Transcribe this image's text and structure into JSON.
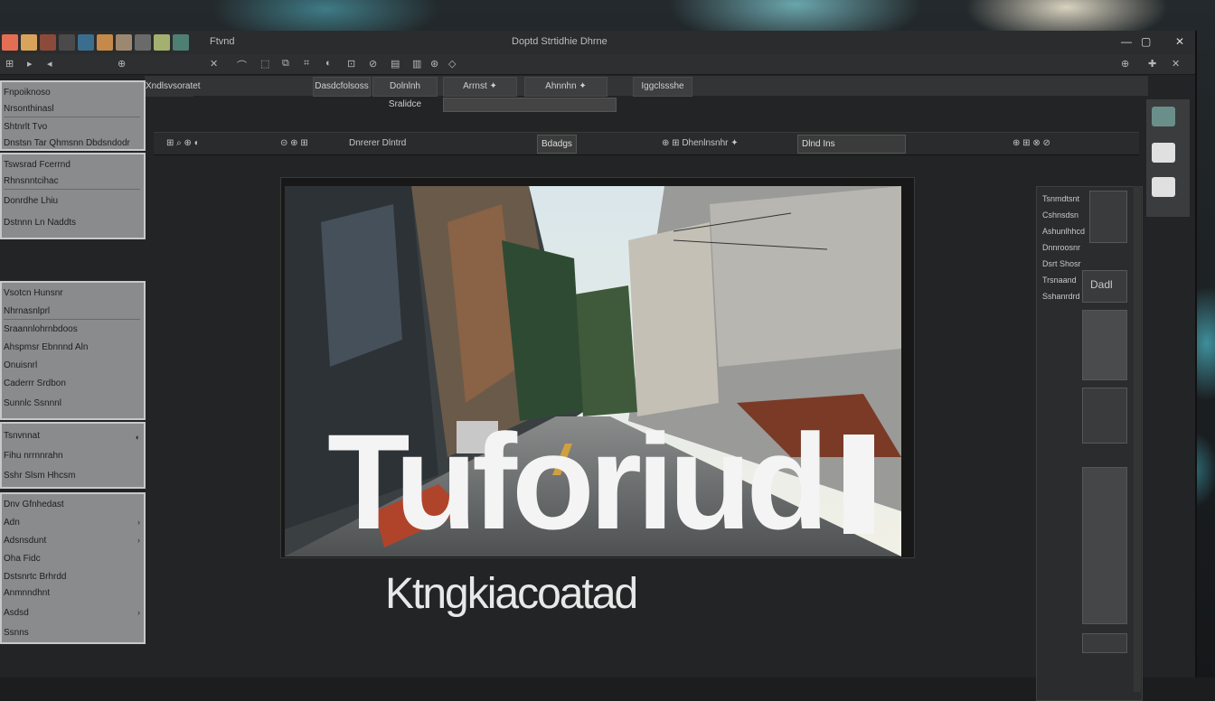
{
  "titlebar": {
    "app_label": "Ftvnd",
    "doc_title": "Doptd Strtidhie Dhrne",
    "win_buttons": [
      "—",
      "▢",
      "✕"
    ],
    "thumb_colors": [
      "#e46e54",
      "#d8a45c",
      "#8b4a3a",
      "#4a4a4a",
      "#3b6e8e",
      "#c58a4a",
      "#9c8870",
      "#6a6a6a",
      "#a4b070",
      "#4e7f73"
    ]
  },
  "toolbar": {
    "glyphs": [
      "⊞",
      "▸",
      "◂",
      "⊕",
      "✕",
      "⌒",
      "⬚",
      "⧉",
      "⌗",
      "◐",
      "⊡",
      "⊘",
      "▤",
      "▥",
      "⊛",
      "◇",
      "⬒",
      "⊠",
      "✚"
    ],
    "right_glyphs": [
      "⊕",
      "✚",
      "✕"
    ]
  },
  "optbar": {
    "left_label": "Xndlsvsoratet",
    "cells": [
      "Dasdcfolsoss",
      "Dolnlnh Sralidce",
      "Arrnst  ✦",
      "Ahnnhn  ✦",
      "Iggclssshe"
    ]
  },
  "ctrlbar": {
    "segments": [
      "⊞ ⌕ ⊕ ◐",
      "⊝ ⊕ ⊞",
      "Dnrerer Dlntrd",
      "Bdadgs",
      "⊕ ⊞ Dhenlnsnhr ✦",
      "Dlnd  Ins",
      "⊕ ⊞ ⊗ ⊘"
    ]
  },
  "left_panel": {
    "sections": [
      {
        "rows": [
          "Fnpoiknoso",
          "Nrsonthinasl",
          "Shtnrlt Tvo",
          "Dnstsn Tar Qhmsnn Dbdsndodr"
        ]
      },
      {
        "rows": [
          "Tswsrad Fcerrnd",
          "Rhnsnntcihac",
          "Donrdhe  Lhiu",
          "Dstnnn Ln Naddts"
        ]
      },
      {
        "rows": [
          "Vsotcn Hunsnr",
          "Nhrnasnlprl",
          "Sraannlohrnbdoos",
          "Ahspmsr Ebnnnd Aln",
          "Onuisnrl",
          "Caderrr Srdbon",
          "Sunnlc Ssnnnl"
        ]
      },
      {
        "rows": [
          "Tsnvnnat",
          "Fihu nrrnnrahn",
          "Sshr Slsm Hhcsm"
        ]
      },
      {
        "rows": [
          "Dnv Gfnhedast",
          "Adn",
          "Adsnsdunt",
          "Oha   Fidc",
          "Dstsnrtc Brhrdd",
          "Anmnndhnt",
          "Asdsd",
          "Ssnns"
        ]
      }
    ]
  },
  "canvas": {
    "title": "Tuforiud",
    "title_bar_glyph": "l",
    "subtitle": "Ktngkiacoatad"
  },
  "right_panel": {
    "rows": [
      "Tsnmdtsnt",
      "Cshnsdsn",
      "Ashunlhhcd",
      "Dnnroosnr",
      "Dsrt  Shosr",
      "Trsnaand",
      "Sshanrdrd"
    ],
    "box_label": "Dadl"
  },
  "colors": {
    "accent_teal": "#3e8f9b",
    "panel_gray": "#8a8b8c",
    "canvas_bg": "#232425",
    "title_white": "#f4f4f4"
  }
}
